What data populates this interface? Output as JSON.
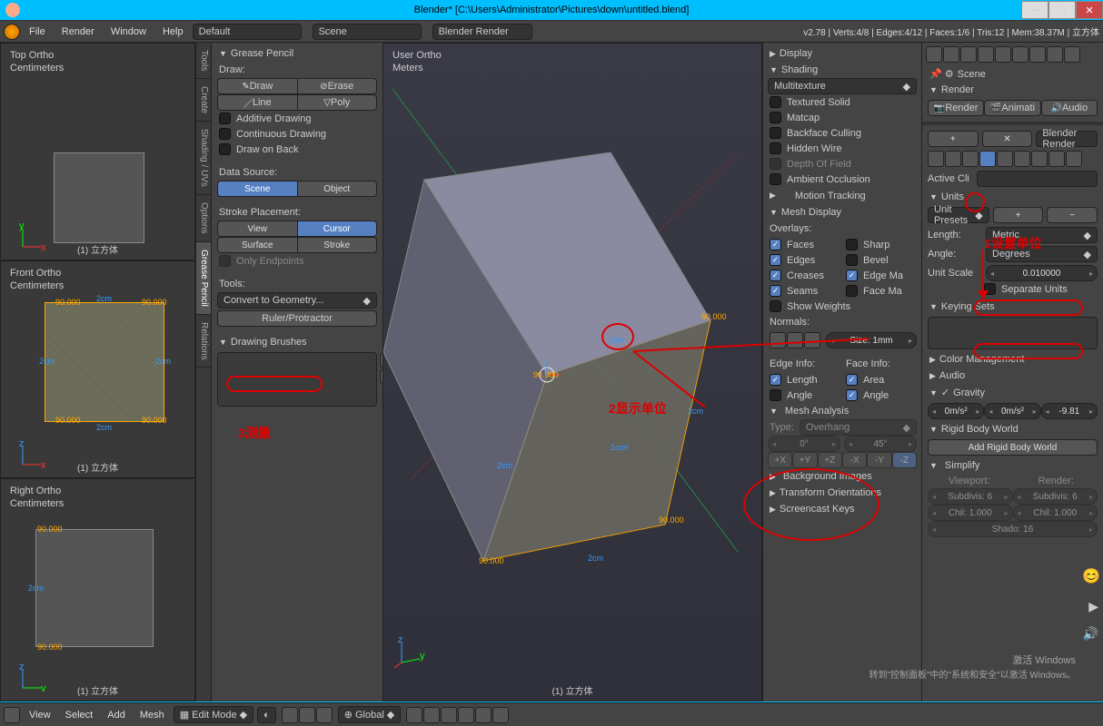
{
  "window": {
    "title": "Blender* [C:\\Users\\Administrator\\Pictures\\down\\untitled.blend]"
  },
  "menu": {
    "file": "File",
    "render": "Render",
    "window": "Window",
    "help": "Help",
    "layout": "Default",
    "scene": "Scene",
    "engine": "Blender Render",
    "stats": "v2.78 | Verts:4/8 | Edges:4/12 | Faces:1/6 | Tris:12 | Mem:38.37M | 立方体"
  },
  "views": {
    "top": {
      "l1": "Top Ortho",
      "l2": "Centimeters",
      "foot": "(1) 立方体"
    },
    "front": {
      "l1": "Front Ortho",
      "l2": "Centimeters",
      "foot": "(1) 立方体"
    },
    "right": {
      "l1": "Right Ortho",
      "l2": "Centimeters",
      "foot": "(1) 立方体"
    },
    "main": {
      "l1": "User Ortho",
      "l2": "Meters",
      "foot": "(1) 立方体"
    }
  },
  "tools": {
    "tabs": [
      "Tools",
      "Create",
      "Shading / UVs",
      "Options",
      "Grease Pencil",
      "Relations"
    ],
    "gp": {
      "title": "Grease Pencil",
      "draw": "Draw:",
      "b_draw": "Draw",
      "b_erase": "Erase",
      "b_line": "Line",
      "b_poly": "Poly",
      "additive": "Additive Drawing",
      "continuous": "Continuous Drawing",
      "drawonback": "Draw on Back",
      "datasource": "Data Source:",
      "scene": "Scene",
      "object": "Object",
      "stroke": "Stroke Placement:",
      "view": "View",
      "cursor": "Cursor",
      "surface": "Surface",
      "strokeb": "Stroke",
      "onlyend": "Only Endpoints",
      "toolsl": "Tools:",
      "convert": "Convert to Geometry...",
      "ruler": "Ruler/Protractor",
      "brushes": "Drawing Brushes"
    }
  },
  "npanel": {
    "display": "Display",
    "shading": "Shading",
    "multitex": "Multitexture",
    "texsolid": "Textured Solid",
    "matcap": "Matcap",
    "backface": "Backface Culling",
    "hidden": "Hidden Wire",
    "dof": "Depth Of Field",
    "ao": "Ambient Occlusion",
    "motion": "Motion Tracking",
    "meshdisp": "Mesh Display",
    "overlays": "Overlays:",
    "faces": "Faces",
    "edges": "Edges",
    "creases": "Creases",
    "seams": "Seams",
    "sharp": "Sharp",
    "bevel": "Bevel",
    "edgema": "Edge Ma",
    "facema": "Face Ma",
    "showw": "Show Weights",
    "normals": "Normals:",
    "edgesize": "Size: 1mm",
    "edgeinfo": "Edge Info:",
    "faceinfo": "Face Info:",
    "length": "Length",
    "angle": "Angle",
    "area": "Area",
    "angle2": "Angle",
    "meshana": "Mesh Analysis",
    "type": "Type:",
    "overhang": "Overhang",
    "deg0": "0°",
    "deg45": "45°",
    "axes": [
      "+X",
      "+Y",
      "+Z",
      "-X",
      "-Y",
      "-Z"
    ],
    "bgimg": "Background Images",
    "transform": "Transform Orientations",
    "screencast": "Screencast Keys"
  },
  "props": {
    "scene": "Scene",
    "render": "Render",
    "btn_render": "Render",
    "btn_anim": "Animati",
    "btn_audio": "Audio",
    "engine": "Blender Render",
    "activecli": "Active Cli",
    "units": "Units",
    "unitpresets": "Unit Presets",
    "length": "Length:",
    "metric": "Metric",
    "angle": "Angle:",
    "degrees": "Degrees",
    "unitscale": "Unit Scale",
    "unitscale_v": "0.010000",
    "separate": "Separate Units",
    "keying": "Keying Sets",
    "colormgmt": "Color Management",
    "audio": "Audio",
    "gravity": "Gravity",
    "g1": "0m/s²",
    "g2": "0m/s²",
    "g3": "-9.81",
    "rigidbody": "Rigid Body World",
    "addrb": "Add Rigid Body World",
    "simplify": "Simplify",
    "viewport": "Viewport:",
    "rendercol": "Render:",
    "subdiv": "Subdivis: 6",
    "chil": "Chil: 1.000",
    "shado": "Shado: 16"
  },
  "annotations": {
    "a1": "1设置单位",
    "a2": "2显示单位",
    "a3": "3测量"
  },
  "footer": {
    "view": "View",
    "select": "Select",
    "add": "Add",
    "mesh": "Mesh",
    "editmode": "Edit Mode",
    "global": "Global"
  },
  "cube": {
    "edge": "2cm",
    "angle": "90.000"
  },
  "watermark": {
    "l1": "激活 Windows",
    "l2": "转到\"控制面板\"中的\"系统和安全\"以激活 Windows。"
  }
}
